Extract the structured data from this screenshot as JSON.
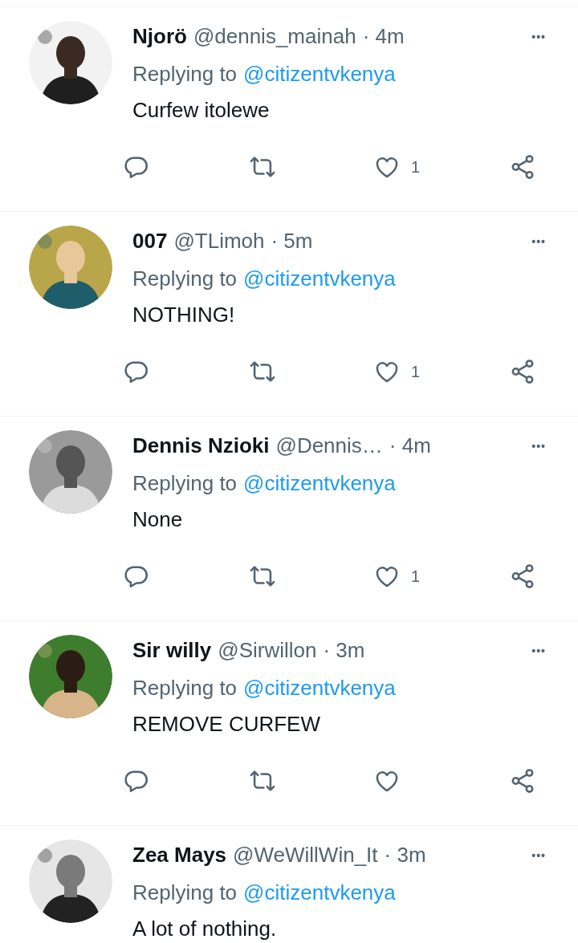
{
  "replies": [
    {
      "name": "Njorö",
      "handle": "@dennis_mainah",
      "time": "· 4m",
      "more": "•••",
      "replying_label": "Replying to",
      "replying_to": "@citizentvkenya",
      "text": "Curfew itolewe",
      "actions": {
        "liked": false,
        "likes": "1"
      }
    },
    {
      "name": "007",
      "handle": "@TLimoh",
      "time": "· 5m",
      "more": "•••",
      "replying_label": "Replying to",
      "replying_to": "@citizentvkenya",
      "text": "NOTHING!",
      "actions": {
        "liked": false,
        "likes": "1"
      }
    },
    {
      "name": "Dennis Nzioki",
      "handle": "@Dennis…",
      "time": "· 4m",
      "more": "•••",
      "replying_label": "Replying to",
      "replying_to": "@citizentvkenya",
      "text": "None",
      "actions": {
        "liked": false,
        "likes": "1"
      }
    },
    {
      "name": "Sir willy",
      "handle": "@Sirwillon",
      "time": "· 3m",
      "more": "•••",
      "replying_label": "Replying to",
      "replying_to": "@citizentvkenya",
      "text": "REMOVE CURFEW",
      "actions": {
        "liked": false
      }
    },
    {
      "name": "Zea Mays",
      "handle": "@WeWillWin_It",
      "time": "· 3m",
      "more": "•••",
      "replying_label": "Replying to",
      "replying_to": "@citizentvkenya",
      "text": "A lot of nothing."
    }
  ]
}
